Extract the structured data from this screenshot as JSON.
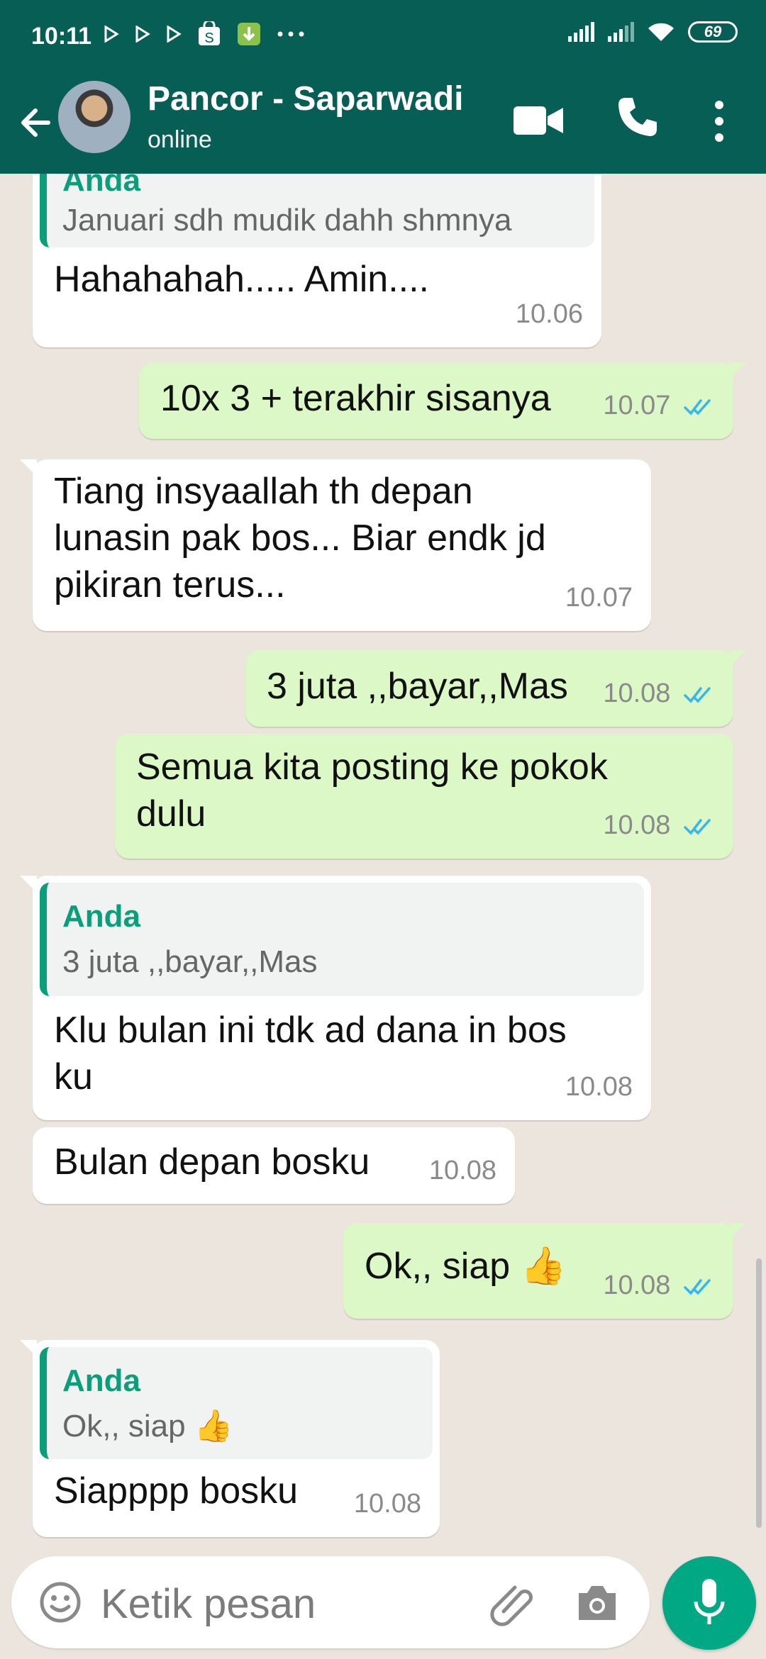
{
  "status_bar": {
    "time": "10:11",
    "battery": "69"
  },
  "header": {
    "contact_name": "Pancor - Saparwadi",
    "status": "online"
  },
  "messages": [
    {
      "type": "in",
      "quote_author": "Anda",
      "quote_text": "Januari sdh mudik dahh shmnya",
      "text": "Hahahahah..... Amin....",
      "time": "10.06"
    },
    {
      "type": "out",
      "text": "10x 3 + terakhir sisanya",
      "time": "10.07"
    },
    {
      "type": "in",
      "text": "Tiang insyaallah th depan\nlunasin pak bos... Biar endk jd\npikiran terus...",
      "time": "10.07"
    },
    {
      "type": "out",
      "text": "3 juta ,,bayar,,Mas",
      "time": "10.08"
    },
    {
      "type": "out",
      "text": "Semua kita posting ke pokok\ndulu",
      "time": "10.08"
    },
    {
      "type": "in",
      "quote_author": "Anda",
      "quote_text": "3 juta ,,bayar,,Mas",
      "text": "Klu bulan ini tdk ad dana in bos\nku",
      "time": "10.08"
    },
    {
      "type": "in",
      "text": "Bulan depan bosku",
      "time": "10.08"
    },
    {
      "type": "out",
      "text": "Ok,, siap 👍",
      "time": "10.08"
    },
    {
      "type": "in",
      "quote_author": "Anda",
      "quote_text": "Ok,, siap 👍",
      "text": "Siapppp bosku",
      "time": "10.08"
    }
  ],
  "input": {
    "placeholder": "Ketik pesan"
  },
  "icons": {
    "back": "arrow-left-icon",
    "video": "video-call-icon",
    "call": "phone-icon",
    "menu": "more-vert-icon",
    "emoji": "emoji-icon",
    "attach": "paperclip-icon",
    "camera": "camera-icon",
    "mic": "mic-icon"
  },
  "colors": {
    "header": "#075E54",
    "outgoing_bubble": "#DCF8C6",
    "incoming_bubble": "#FFFFFF",
    "accent": "#00A884",
    "read_ticks": "#34B7F1"
  }
}
